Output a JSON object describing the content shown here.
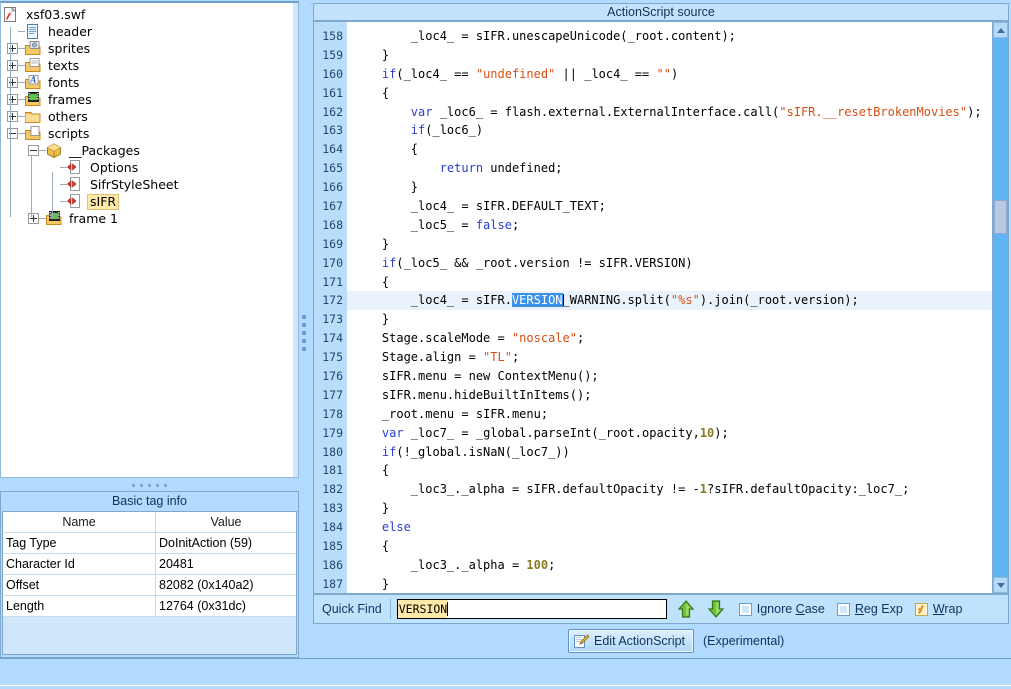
{
  "window": {
    "editor_title": "ActionScript source"
  },
  "tree": {
    "root": {
      "label": "xsf03.swf",
      "icon": "swf-file-icon"
    },
    "nodes": [
      {
        "label": "header",
        "icon": "document-icon",
        "expander": "none",
        "depth": 1
      },
      {
        "label": "sprites",
        "icon": "sprites-folder-icon",
        "expander": "plus",
        "depth": 1
      },
      {
        "label": "texts",
        "icon": "texts-folder-icon",
        "expander": "plus",
        "depth": 1
      },
      {
        "label": "fonts",
        "icon": "fonts-folder-icon",
        "expander": "plus",
        "depth": 1
      },
      {
        "label": "frames",
        "icon": "frames-folder-icon",
        "expander": "plus",
        "depth": 1
      },
      {
        "label": "others",
        "icon": "folder-icon",
        "expander": "plus",
        "depth": 1
      },
      {
        "label": "scripts",
        "icon": "scripts-folder-icon",
        "expander": "minus",
        "depth": 1
      },
      {
        "label": "__Packages",
        "icon": "package-icon",
        "expander": "minus",
        "depth": 2
      },
      {
        "label": "Options",
        "icon": "actionscript-icon",
        "expander": "none",
        "depth": 3
      },
      {
        "label": "SifrStyleSheet",
        "icon": "actionscript-icon",
        "expander": "none",
        "depth": 3
      },
      {
        "label": "sIFR",
        "icon": "actionscript-icon",
        "expander": "none",
        "depth": 3,
        "selected": true
      },
      {
        "label": "frame 1",
        "icon": "frames-folder-icon",
        "expander": "plus",
        "depth": 2
      }
    ]
  },
  "basic_tag_info": {
    "title": "Basic tag info",
    "columns": [
      "Name",
      "Value"
    ],
    "rows": [
      [
        "Tag Type",
        "DoInitAction (59)"
      ],
      [
        "Character Id",
        "20481"
      ],
      [
        "Offset",
        "82082 (0x140a2)"
      ],
      [
        "Length",
        "12764 (0x31dc)"
      ]
    ]
  },
  "code": {
    "first_line_number": 158,
    "current_line_number": 172,
    "lines": [
      {
        "n": 158,
        "tokens": [
          {
            "t": "        _loc4_ = sIFR.unescapeUnicode(_root.content);"
          }
        ]
      },
      {
        "n": 159,
        "tokens": [
          {
            "t": "    }"
          }
        ]
      },
      {
        "n": 160,
        "tokens": [
          {
            "t": "    "
          },
          {
            "t": "if",
            "c": "kw"
          },
          {
            "t": "(_loc4_ == "
          },
          {
            "t": "\"undefined\"",
            "c": "str"
          },
          {
            "t": " || _loc4_ == "
          },
          {
            "t": "\"\"",
            "c": "str"
          },
          {
            "t": ")"
          }
        ]
      },
      {
        "n": 161,
        "tokens": [
          {
            "t": "    {"
          }
        ]
      },
      {
        "n": 162,
        "tokens": [
          {
            "t": "        "
          },
          {
            "t": "var",
            "c": "kw"
          },
          {
            "t": " _loc6_ = flash.external.ExternalInterface.call("
          },
          {
            "t": "\"sIFR.__resetBrokenMovies\"",
            "c": "str"
          },
          {
            "t": ");"
          }
        ]
      },
      {
        "n": 163,
        "tokens": [
          {
            "t": "        "
          },
          {
            "t": "if",
            "c": "kw"
          },
          {
            "t": "(_loc6_)"
          }
        ]
      },
      {
        "n": 164,
        "tokens": [
          {
            "t": "        {"
          }
        ]
      },
      {
        "n": 165,
        "tokens": [
          {
            "t": "            "
          },
          {
            "t": "return",
            "c": "kw"
          },
          {
            "t": " undefined;"
          }
        ]
      },
      {
        "n": 166,
        "tokens": [
          {
            "t": "        }"
          }
        ]
      },
      {
        "n": 167,
        "tokens": [
          {
            "t": "        _loc4_ = sIFR.DEFAULT_TEXT;"
          }
        ]
      },
      {
        "n": 168,
        "tokens": [
          {
            "t": "        _loc5_ = "
          },
          {
            "t": "false",
            "c": "kw"
          },
          {
            "t": ";"
          }
        ]
      },
      {
        "n": 169,
        "tokens": [
          {
            "t": "    }"
          }
        ]
      },
      {
        "n": 170,
        "tokens": [
          {
            "t": "    "
          },
          {
            "t": "if",
            "c": "kw"
          },
          {
            "t": "(_loc5_ && _root.version != sIFR.VERSION)"
          }
        ]
      },
      {
        "n": 171,
        "tokens": [
          {
            "t": "    {"
          }
        ]
      },
      {
        "n": 172,
        "current": true,
        "tokens": [
          {
            "t": "        _loc4_ = sIFR."
          },
          {
            "t": "VERSION",
            "c": "selx"
          },
          {
            "t": "|CARET|"
          },
          {
            "t": "_WARNING.split("
          },
          {
            "t": "\"%s\"",
            "c": "str"
          },
          {
            "t": ").join(_root.version);"
          }
        ]
      },
      {
        "n": 173,
        "tokens": [
          {
            "t": "    }"
          }
        ]
      },
      {
        "n": 174,
        "tokens": [
          {
            "t": "    Stage.scaleMode = "
          },
          {
            "t": "\"noscale\"",
            "c": "str"
          },
          {
            "t": ";"
          }
        ]
      },
      {
        "n": 175,
        "tokens": [
          {
            "t": "    Stage.align = "
          },
          {
            "t": "\"TL\"",
            "c": "str"
          },
          {
            "t": ";"
          }
        ]
      },
      {
        "n": 176,
        "tokens": [
          {
            "t": "    sIFR.menu = new ContextMenu();"
          }
        ]
      },
      {
        "n": 177,
        "tokens": [
          {
            "t": "    sIFR.menu.hideBuiltInItems();"
          }
        ]
      },
      {
        "n": 178,
        "tokens": [
          {
            "t": "    _root.menu = sIFR.menu;"
          }
        ]
      },
      {
        "n": 179,
        "tokens": [
          {
            "t": "    "
          },
          {
            "t": "var",
            "c": "kw"
          },
          {
            "t": " _loc7_ = _global.parseInt(_root.opacity,"
          },
          {
            "t": "10",
            "c": "num"
          },
          {
            "t": ");"
          }
        ]
      },
      {
        "n": 180,
        "tokens": [
          {
            "t": "    "
          },
          {
            "t": "if",
            "c": "kw"
          },
          {
            "t": "(!_global.isNaN(_loc7_))"
          }
        ]
      },
      {
        "n": 181,
        "tokens": [
          {
            "t": "    {"
          }
        ]
      },
      {
        "n": 182,
        "tokens": [
          {
            "t": "        _loc3_._alpha = sIFR.defaultOpacity != -"
          },
          {
            "t": "1",
            "c": "num"
          },
          {
            "t": "?sIFR.defaultOpacity:_loc7_;"
          }
        ]
      },
      {
        "n": 183,
        "tokens": [
          {
            "t": "    }"
          }
        ]
      },
      {
        "n": 184,
        "tokens": [
          {
            "t": "    "
          },
          {
            "t": "else",
            "c": "kw"
          }
        ]
      },
      {
        "n": 185,
        "tokens": [
          {
            "t": "    {"
          }
        ]
      },
      {
        "n": 186,
        "tokens": [
          {
            "t": "        _loc3_._alpha = "
          },
          {
            "t": "100",
            "c": "num"
          },
          {
            "t": ";"
          }
        ]
      },
      {
        "n": 187,
        "tokens": [
          {
            "t": "    }"
          }
        ]
      }
    ]
  },
  "findbar": {
    "label": "Quick Find",
    "value": "VERSION",
    "placeholder": "",
    "prev_icon": "arrow-up-icon",
    "next_icon": "arrow-down-icon",
    "options": [
      {
        "id": "ignore-case",
        "label_pre": "Ignore ",
        "label_mn": "C",
        "label_post": "ase",
        "checked": false
      },
      {
        "id": "reg-exp",
        "label_pre": "",
        "label_mn": "R",
        "label_post": "eg Exp",
        "checked": false
      },
      {
        "id": "wrap",
        "label_pre": "",
        "label_mn": "W",
        "label_post": "rap",
        "checked": true
      }
    ]
  },
  "actions": {
    "edit_button_label": "Edit ActionScript",
    "edit_button_icon": "pencil-edit-icon",
    "experimental_note": "(Experimental)"
  },
  "colors": {
    "window_bg": "#b3daff",
    "panel_header_bg": "#c3e2fb",
    "gutter_bg": "#b9ddfb",
    "selection_blue": "#3a92e8",
    "tree_selection": "#ffe9a8",
    "keyword": "#2b3fd0",
    "string": "#d94f14",
    "number": "#8a7a20",
    "current_line": "#eaf2fb"
  }
}
